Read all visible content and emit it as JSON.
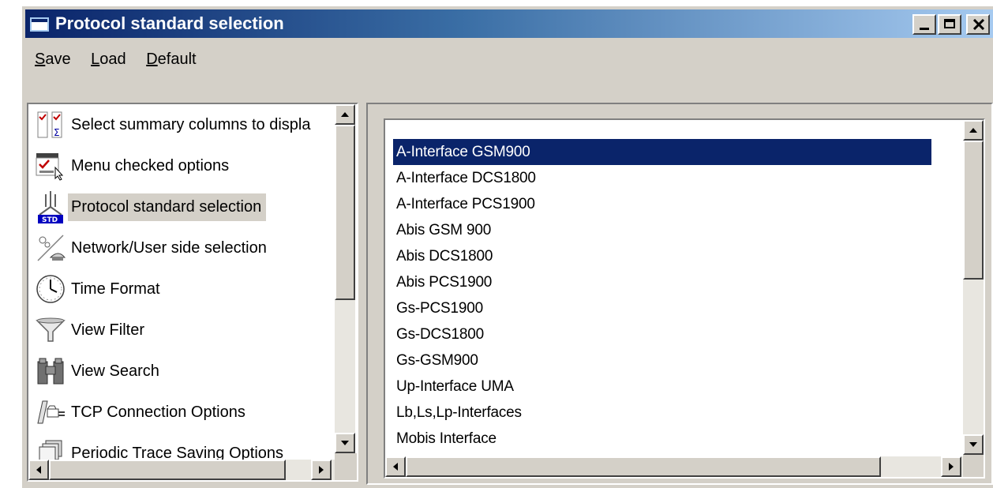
{
  "window": {
    "title": "Protocol standard selection",
    "title_icon": "app-window-icon",
    "controls": {
      "minimize_icon": "minimize-icon",
      "maximize_icon": "maximize-icon",
      "close_icon": "close-icon"
    }
  },
  "menubar": {
    "items": [
      {
        "label": "Save",
        "mnemonic": "S",
        "rest": "ave"
      },
      {
        "label": "Load",
        "mnemonic": "L",
        "rest": "oad"
      },
      {
        "label": "Default",
        "mnemonic": "D",
        "rest": "efault"
      }
    ]
  },
  "sidebar": {
    "items": [
      {
        "label": "Select summary columns to displa",
        "icon": "summary-columns-icon",
        "selected": false
      },
      {
        "label": "Menu checked options",
        "icon": "menu-checked-icon",
        "selected": false
      },
      {
        "label": "Protocol standard selection",
        "icon": "protocol-std-icon",
        "selected": true
      },
      {
        "label": "Network/User side selection",
        "icon": "network-user-icon",
        "selected": false
      },
      {
        "label": "Time Format",
        "icon": "clock-icon",
        "selected": false
      },
      {
        "label": "View Filter",
        "icon": "filter-icon",
        "selected": false
      },
      {
        "label": "View Search",
        "icon": "binoculars-icon",
        "selected": false
      },
      {
        "label": "TCP Connection Options",
        "icon": "tcp-connection-icon",
        "selected": false
      },
      {
        "label": "Periodic Trace Saving Options",
        "icon": "periodic-save-icon",
        "selected": false
      }
    ],
    "std_badge": "STD"
  },
  "protocols": {
    "selected_index": 0,
    "items": [
      "A-Interface GSM900",
      "A-Interface DCS1800",
      "A-Interface PCS1900",
      "Abis GSM 900",
      "Abis DCS1800",
      "Abis PCS1900",
      "Gs-PCS1900",
      "Gs-DCS1800",
      "Gs-GSM900",
      "Up-Interface UMA",
      "Lb,Ls,Lp-Interfaces",
      "Mobis Interface"
    ]
  },
  "colors": {
    "selection": "#0a246a",
    "face": "#d4d0c8",
    "title_gradient_start": "#0a246a",
    "title_gradient_end": "#a6caf0"
  }
}
